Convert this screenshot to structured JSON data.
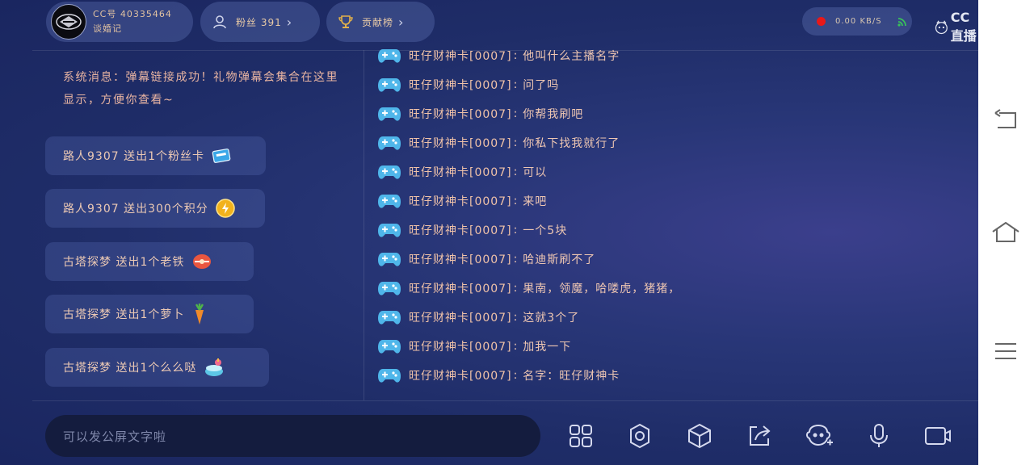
{
  "header": {
    "anchor_id": "CC号 40335464",
    "anchor_sub": "谈婚记",
    "fans_label": "粉丝 391",
    "rank_label": "贡献榜",
    "net_value": "0.00 KB/S",
    "logo_text": "CC直播"
  },
  "left": {
    "system_message": "系统消息：弹幕链接成功！礼物弹幕会集合在这里显示，方便你查看~",
    "gifts": [
      {
        "text": "路人9307 送出1个粉丝卡",
        "icon": "fan-card-icon"
      },
      {
        "text": "路人9307 送出300个积分",
        "icon": "coin-icon"
      },
      {
        "text": "古塔探梦 送出1个老铁",
        "icon": "tiesuo-icon"
      },
      {
        "text": "古塔探梦 送出1个萝卜",
        "icon": "carrot-icon"
      },
      {
        "text": "古塔探梦 送出1个么么哒",
        "icon": "cake-icon"
      }
    ]
  },
  "chat": [
    {
      "name": "旺仔财神卡[0007]",
      "msg": "他叫什么主播名字"
    },
    {
      "name": "旺仔财神卡[0007]",
      "msg": "问了吗"
    },
    {
      "name": "旺仔财神卡[0007]",
      "msg": "你帮我刷吧"
    },
    {
      "name": "旺仔财神卡[0007]",
      "msg": "你私下找我就行了"
    },
    {
      "name": "旺仔财神卡[0007]",
      "msg": "可以"
    },
    {
      "name": "旺仔财神卡[0007]",
      "msg": "来吧"
    },
    {
      "name": "旺仔财神卡[0007]",
      "msg": "一个5块"
    },
    {
      "name": "旺仔财神卡[0007]",
      "msg": "哈迪斯刷不了"
    },
    {
      "name": "旺仔财神卡[0007]",
      "msg": "果南，领魔，哈喽虎，猪猪，"
    },
    {
      "name": "旺仔财神卡[0007]",
      "msg": "这就3个了"
    },
    {
      "name": "旺仔财神卡[0007]",
      "msg": "加我一下"
    },
    {
      "name": "旺仔财神卡[0007]",
      "msg": "名字：旺仔财神卡"
    }
  ],
  "input": {
    "placeholder": "可以发公屏文字啦"
  },
  "colors": {
    "accent": "#e7c9a6",
    "live_dot": "#e81818",
    "signal": "#39c15b"
  }
}
